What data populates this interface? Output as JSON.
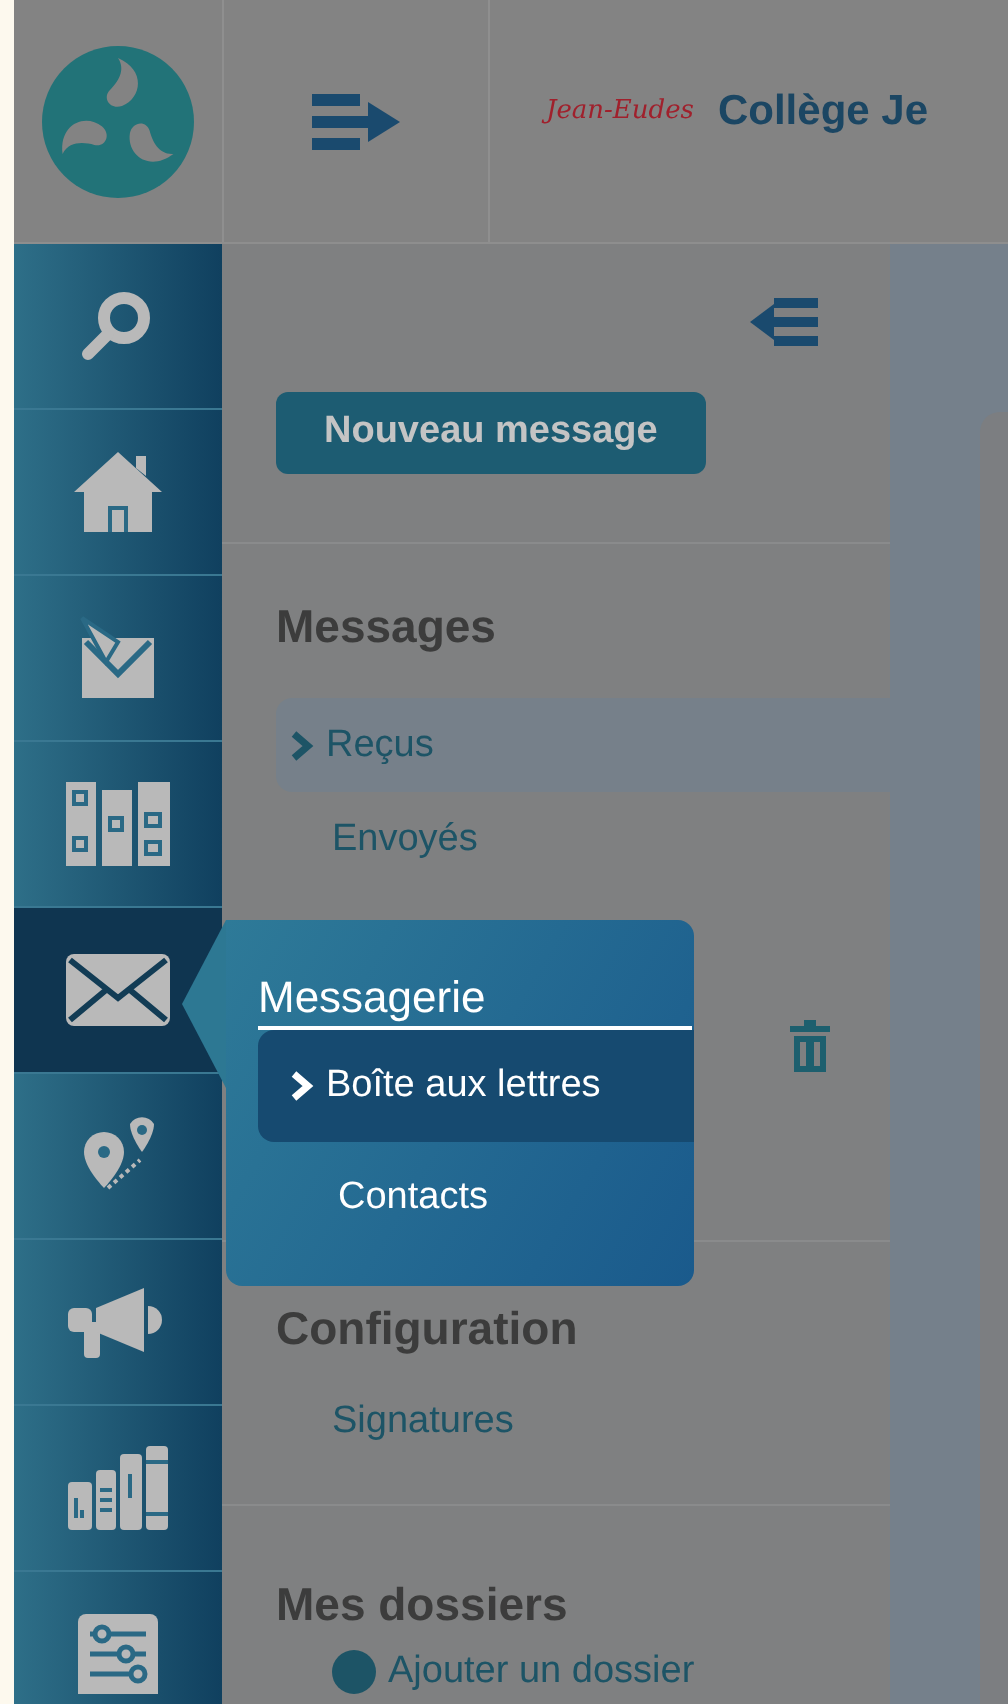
{
  "header": {
    "brand_signature": "Jean-Eudes",
    "school_name": "Collège Je"
  },
  "icon_bar": {
    "items": [
      {
        "kind": "search",
        "selected": false
      },
      {
        "kind": "home",
        "selected": false
      },
      {
        "kind": "pinned-mail",
        "selected": false
      },
      {
        "kind": "grid",
        "selected": false
      },
      {
        "kind": "mail",
        "selected": true
      },
      {
        "kind": "route",
        "selected": false
      },
      {
        "kind": "megaphone",
        "selected": false
      },
      {
        "kind": "books",
        "selected": false
      },
      {
        "kind": "sliders",
        "selected": false
      }
    ]
  },
  "mail_nav": {
    "new_message_button": "Nouveau message",
    "sections": [
      {
        "title": "Messages",
        "items": [
          {
            "label": "Reçus",
            "selected": true
          },
          {
            "label": "Envoyés",
            "selected": false
          }
        ],
        "trash": true
      },
      {
        "title": "Configuration",
        "items": [
          {
            "label": "Signatures",
            "selected": false
          }
        ],
        "trash": false
      },
      {
        "title": "Mes dossiers",
        "items": [
          {
            "label": "Ajouter un dossier",
            "selected": false,
            "kind": "add"
          }
        ],
        "trash": false
      }
    ]
  },
  "flyout": {
    "title": "Messagerie",
    "items": [
      {
        "label": "Boîte aux lettres",
        "selected": true
      },
      {
        "label": "Contacts",
        "selected": false
      }
    ]
  }
}
